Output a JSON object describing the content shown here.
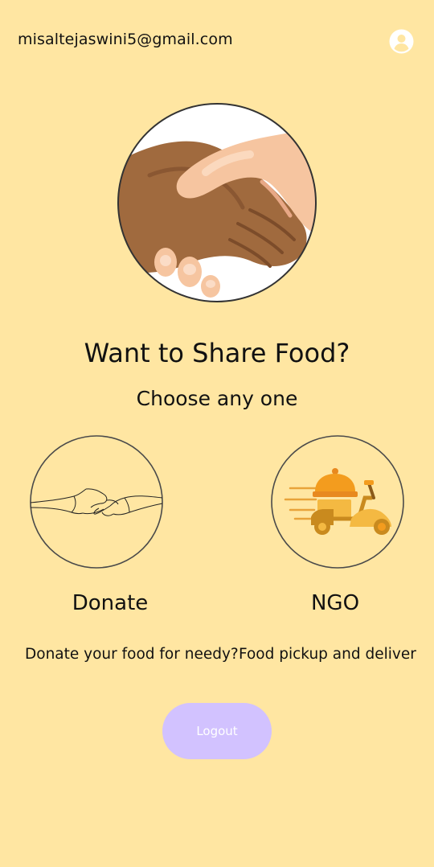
{
  "header": {
    "email": "misaltejaswini5@gmail.com",
    "profile_icon": "account-circle-icon"
  },
  "hero": {
    "icon": "handshake-illustration"
  },
  "main": {
    "title": "Want to Share Food?",
    "subtitle": "Choose any one"
  },
  "options": [
    {
      "label": "Donate",
      "description": "Donate your food for needy?",
      "icon": "hands-reaching-icon"
    },
    {
      "label": "NGO",
      "description": "Food pickup and deliver",
      "icon": "delivery-scooter-icon"
    }
  ],
  "actions": {
    "logout_label": "Logout"
  },
  "colors": {
    "background": "#FFE6A2",
    "logout_button": "#D2C2FF",
    "logout_text": "#FFFFFF",
    "circle_border": "#4A4A4A"
  }
}
